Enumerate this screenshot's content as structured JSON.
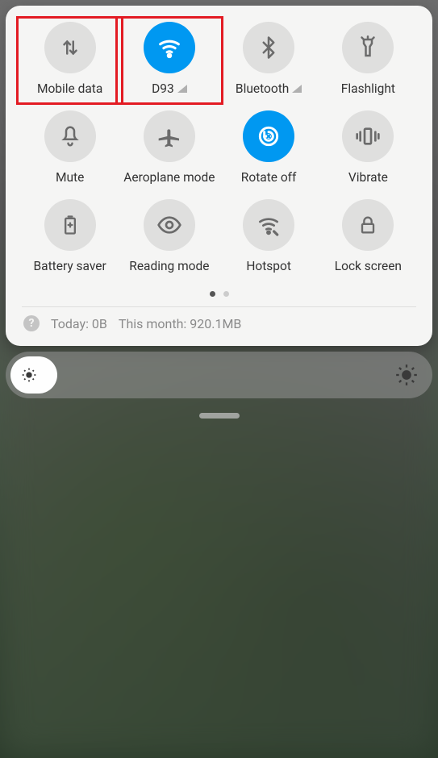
{
  "tiles": [
    {
      "label": "Mobile data",
      "icon": "mobile-data",
      "active": false,
      "highlighted": true,
      "signal": false
    },
    {
      "label": "D93",
      "icon": "wifi",
      "active": true,
      "highlighted": true,
      "signal": true
    },
    {
      "label": "Bluetooth",
      "icon": "bluetooth",
      "active": false,
      "highlighted": false,
      "signal": true
    },
    {
      "label": "Flashlight",
      "icon": "flashlight",
      "active": false,
      "highlighted": false,
      "signal": false
    },
    {
      "label": "Mute",
      "icon": "mute",
      "active": false,
      "highlighted": false,
      "signal": false
    },
    {
      "label": "Aeroplane mode",
      "icon": "airplane",
      "active": false,
      "highlighted": false,
      "signal": false
    },
    {
      "label": "Rotate off",
      "icon": "rotate",
      "active": true,
      "highlighted": false,
      "signal": false
    },
    {
      "label": "Vibrate",
      "icon": "vibrate",
      "active": false,
      "highlighted": false,
      "signal": false
    },
    {
      "label": "Battery saver",
      "icon": "battery",
      "active": false,
      "highlighted": false,
      "signal": false
    },
    {
      "label": "Reading mode",
      "icon": "eye",
      "active": false,
      "highlighted": false,
      "signal": false
    },
    {
      "label": "Hotspot",
      "icon": "hotspot",
      "active": false,
      "highlighted": false,
      "signal": false
    },
    {
      "label": "Lock screen",
      "icon": "lock",
      "active": false,
      "highlighted": false,
      "signal": false
    }
  ],
  "pagination": {
    "total": 2,
    "active": 0
  },
  "usage": {
    "today_label": "Today: 0B",
    "month_label": "This month: 920.1MB"
  },
  "info_glyph": "?"
}
